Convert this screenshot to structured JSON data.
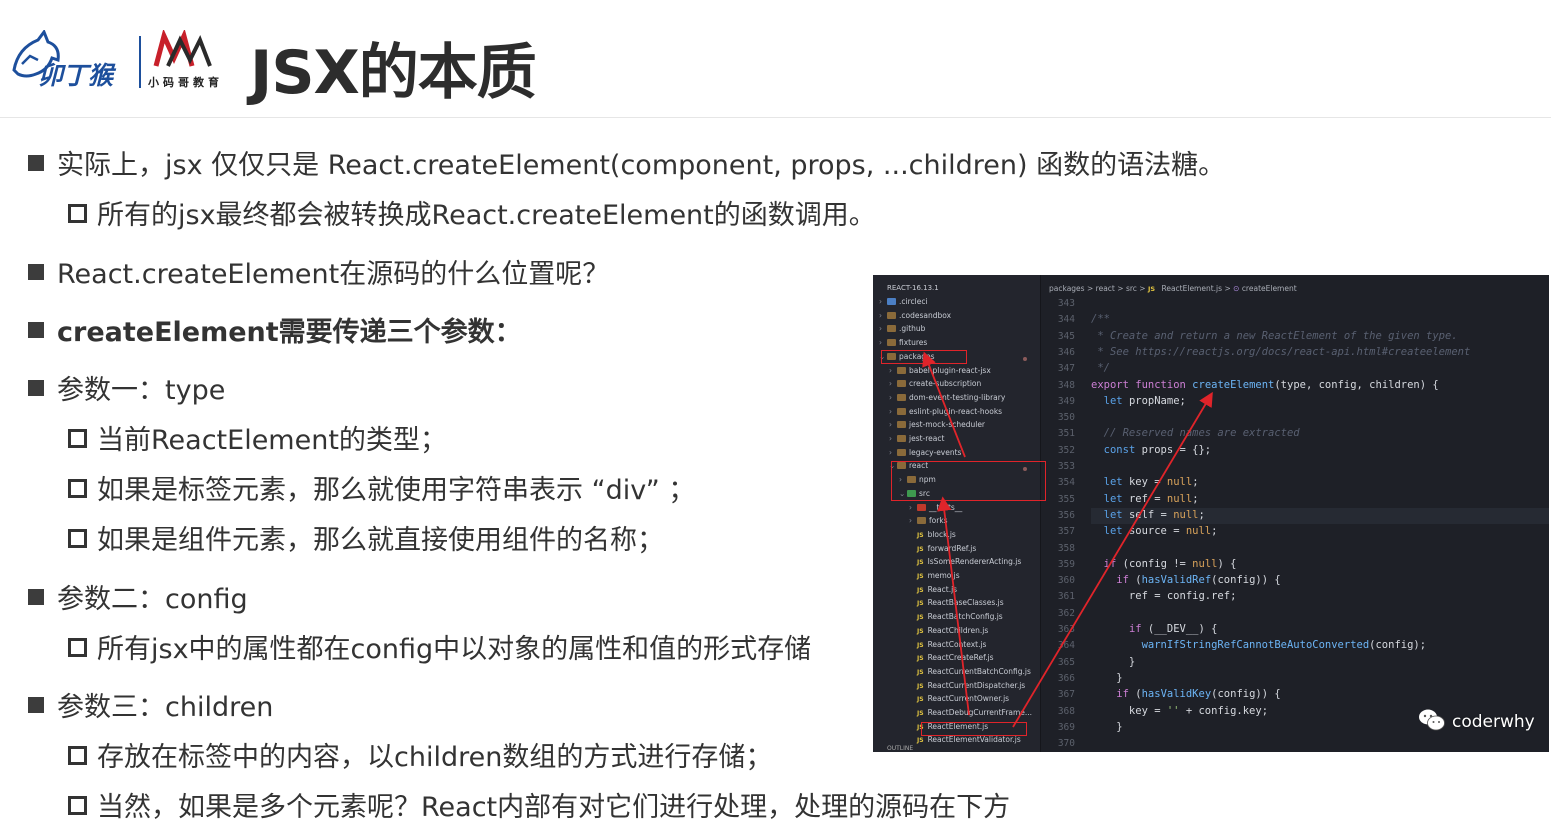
{
  "header": {
    "title": "JSX的本质",
    "logo1_text": "卯丁猴",
    "logo2_text": "小码哥教育"
  },
  "content": {
    "lines": [
      {
        "level": 1,
        "text": "实际上，jsx 仅仅只是 React.createElement(component, props, ...children) 函数的语法糖。",
        "bold": false
      },
      {
        "level": 2,
        "text": "所有的jsx最终都会被转换成React.createElement的函数调用。",
        "bold": false
      },
      {
        "level": 1,
        "text": "React.createElement在源码的什么位置呢？",
        "bold": false
      },
      {
        "level": 1,
        "text": "createElement需要传递三个参数：",
        "bold": true
      },
      {
        "level": 1,
        "text": "参数一：type",
        "bold": false
      },
      {
        "level": 2,
        "text": "当前ReactElement的类型；",
        "bold": false
      },
      {
        "level": 2,
        "text": "如果是标签元素，那么就使用字符串表示 “div” ；",
        "bold": false
      },
      {
        "level": 2,
        "text": "如果是组件元素，那么就直接使用组件的名称；",
        "bold": false
      },
      {
        "level": 1,
        "text": "参数二：config",
        "bold": false
      },
      {
        "level": 2,
        "text": "所有jsx中的属性都在config中以对象的属性和值的形式存储",
        "bold": false
      },
      {
        "level": 1,
        "text": "参数三：children",
        "bold": false
      },
      {
        "level": 2,
        "text": "存放在标签中的内容，以children数组的方式进行存储；",
        "bold": false
      },
      {
        "level": 2,
        "text": "当然，如果是多个元素呢？React内部有对它们进行处理，处理的源码在下方",
        "bold": false
      }
    ]
  },
  "screenshot": {
    "explorer_title": "REACT-16.13.1",
    "tree": [
      {
        "label": ".circleci",
        "kind": "folder-blue",
        "indent": 0
      },
      {
        "label": ".codesandbox",
        "kind": "folder",
        "indent": 0
      },
      {
        "label": ".github",
        "kind": "folder",
        "indent": 0
      },
      {
        "label": "fixtures",
        "kind": "folder",
        "indent": 0
      },
      {
        "label": "packages",
        "kind": "folder-open",
        "indent": 0
      },
      {
        "label": "babel-plugin-react-jsx",
        "kind": "folder",
        "indent": 1
      },
      {
        "label": "create-subscription",
        "kind": "folder",
        "indent": 1
      },
      {
        "label": "dom-event-testing-library",
        "kind": "folder",
        "indent": 1
      },
      {
        "label": "eslint-plugin-react-hooks",
        "kind": "folder",
        "indent": 1
      },
      {
        "label": "jest-mock-scheduler",
        "kind": "folder",
        "indent": 1
      },
      {
        "label": "jest-react",
        "kind": "folder",
        "indent": 1
      },
      {
        "label": "legacy-events",
        "kind": "folder",
        "indent": 1
      },
      {
        "label": "react",
        "kind": "folder-open",
        "indent": 1
      },
      {
        "label": "npm",
        "kind": "folder",
        "indent": 2
      },
      {
        "label": "src",
        "kind": "folder-green-open",
        "indent": 2
      },
      {
        "label": "__tests__",
        "kind": "folder-red",
        "indent": 3
      },
      {
        "label": "forks",
        "kind": "folder",
        "indent": 3
      },
      {
        "label": "block.js",
        "kind": "js",
        "indent": 3
      },
      {
        "label": "forwardRef.js",
        "kind": "js",
        "indent": 3
      },
      {
        "label": "IsSomeRendererActing.js",
        "kind": "js",
        "indent": 3
      },
      {
        "label": "memo.js",
        "kind": "js",
        "indent": 3
      },
      {
        "label": "React.js",
        "kind": "js",
        "indent": 3
      },
      {
        "label": "ReactBaseClasses.js",
        "kind": "js",
        "indent": 3
      },
      {
        "label": "ReactBatchConfig.js",
        "kind": "js",
        "indent": 3
      },
      {
        "label": "ReactChildren.js",
        "kind": "js",
        "indent": 3
      },
      {
        "label": "ReactContext.js",
        "kind": "js",
        "indent": 3
      },
      {
        "label": "ReactCreateRef.js",
        "kind": "js",
        "indent": 3
      },
      {
        "label": "ReactCurrentBatchConfig.js",
        "kind": "js",
        "indent": 3
      },
      {
        "label": "ReactCurrentDispatcher.js",
        "kind": "js",
        "indent": 3
      },
      {
        "label": "ReactCurrentOwner.js",
        "kind": "js",
        "indent": 3
      },
      {
        "label": "ReactDebugCurrentFrame...",
        "kind": "js",
        "indent": 3
      },
      {
        "label": "ReactElement.js",
        "kind": "js",
        "indent": 3
      },
      {
        "label": "ReactElementValidator.js",
        "kind": "js",
        "indent": 3
      }
    ],
    "outline_label": "OUTLINE",
    "breadcrumb": {
      "parts": [
        "packages",
        "react",
        "src"
      ],
      "file": "ReactElement.js",
      "symbol": "createElement",
      "sep": ">",
      "js_badge": "JS",
      "symbol_icon": "⊙"
    },
    "code_lines": [
      {
        "n": "343",
        "t": ""
      },
      {
        "n": "344",
        "t": "/**"
      },
      {
        "n": "345",
        "t": " * Create and return a new ReactElement of the given type."
      },
      {
        "n": "346",
        "t": " * See https://reactjs.org/docs/react-api.html#createelement"
      },
      {
        "n": "347",
        "t": " */"
      },
      {
        "n": "348",
        "t": "export function createElement(type, config, children) {"
      },
      {
        "n": "349",
        "t": "  let propName;"
      },
      {
        "n": "350",
        "t": ""
      },
      {
        "n": "351",
        "t": "  // Reserved names are extracted"
      },
      {
        "n": "352",
        "t": "  const props = {};"
      },
      {
        "n": "353",
        "t": ""
      },
      {
        "n": "354",
        "t": "  let key = null;"
      },
      {
        "n": "355",
        "t": "  let ref = null;"
      },
      {
        "n": "356",
        "t": "  let self = null;"
      },
      {
        "n": "357",
        "t": "  let source = null;"
      },
      {
        "n": "358",
        "t": ""
      },
      {
        "n": "359",
        "t": "  if (config != null) {"
      },
      {
        "n": "360",
        "t": "    if (hasValidRef(config)) {"
      },
      {
        "n": "361",
        "t": "      ref = config.ref;"
      },
      {
        "n": "362",
        "t": ""
      },
      {
        "n": "363",
        "t": "      if (__DEV__) {"
      },
      {
        "n": "364",
        "t": "        warnIfStringRefCannotBeAutoConverted(config);"
      },
      {
        "n": "365",
        "t": "      }"
      },
      {
        "n": "366",
        "t": "    }"
      },
      {
        "n": "367",
        "t": "    if (hasValidKey(config)) {"
      },
      {
        "n": "368",
        "t": "      key = '' + config.key;"
      },
      {
        "n": "369",
        "t": "    }"
      },
      {
        "n": "370",
        "t": ""
      }
    ]
  },
  "watermark": {
    "text": "coderwhy",
    "icon": "wechat-icon"
  },
  "colors": {
    "accent_red": "#e0242a",
    "editor_bg": "#1e2027",
    "logo_blue": "#1d4f9c",
    "logo_red": "#c8202a"
  }
}
